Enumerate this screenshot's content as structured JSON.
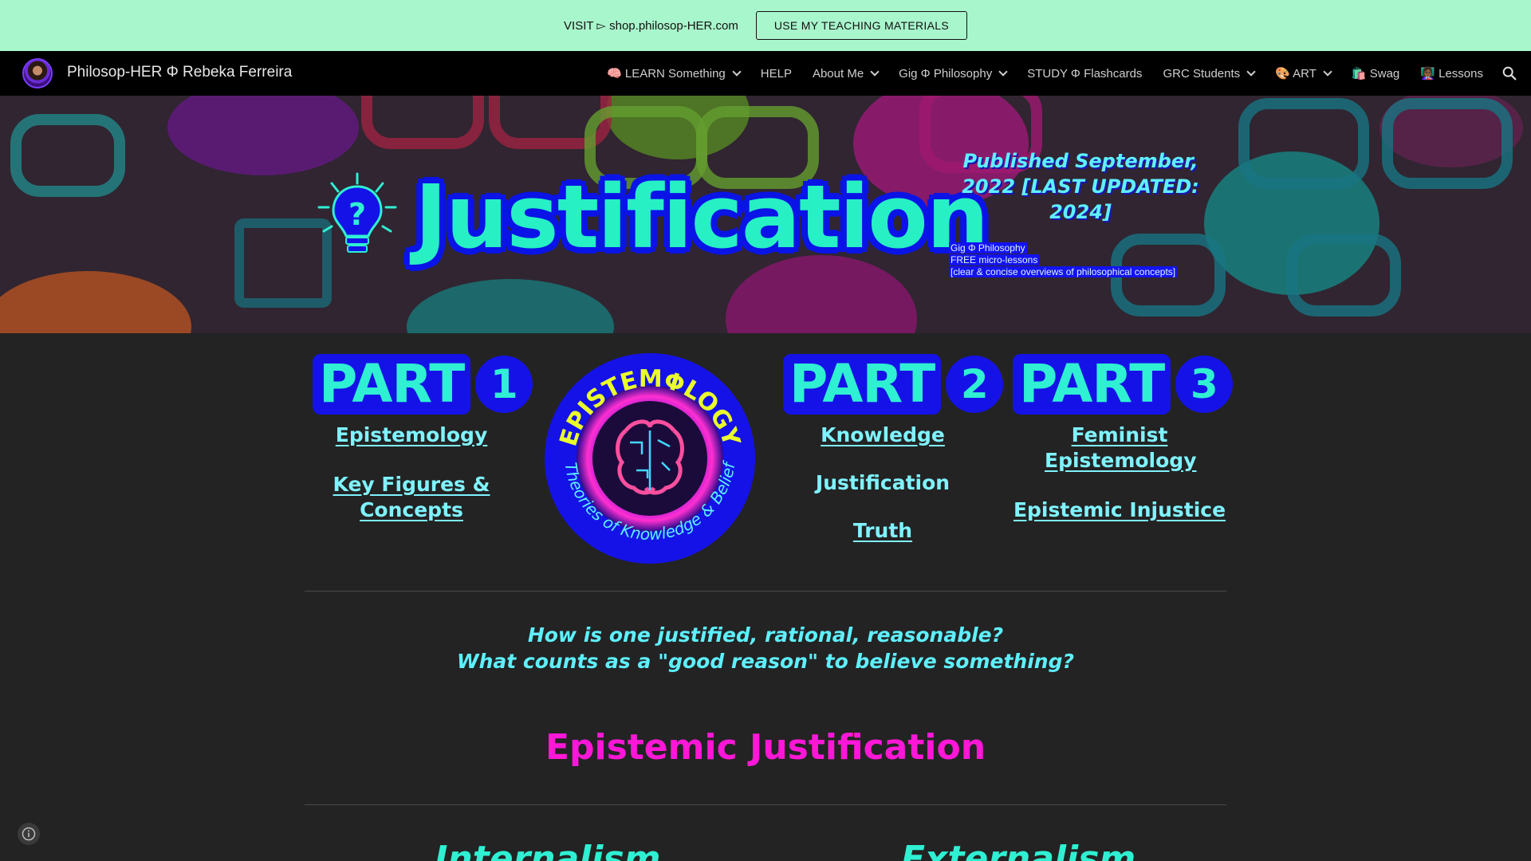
{
  "promo": {
    "text": "VISIT ▻ shop.philosop-HER.com",
    "button": "USE MY TEACHING MATERIALS"
  },
  "nav": {
    "site_title": "Philosop-HER Φ Rebeka Ferreira",
    "items": [
      {
        "label": "🧠 LEARN Something",
        "dropdown": true
      },
      {
        "label": "HELP",
        "dropdown": false
      },
      {
        "label": "About Me",
        "dropdown": true
      },
      {
        "label": "Gig Φ Philosophy",
        "dropdown": true
      },
      {
        "label": "STUDY Φ Flashcards",
        "dropdown": false
      },
      {
        "label": "GRC Students",
        "dropdown": true
      },
      {
        "label": "🎨 ART",
        "dropdown": true
      },
      {
        "label": "🛍️ Swag",
        "dropdown": false
      },
      {
        "label": "👩🏾‍🏫 Lessons",
        "dropdown": false
      }
    ]
  },
  "hero": {
    "title": "Justification",
    "published": "Published September, 2022 [LAST UPDATED: 2024]",
    "micro_lines": [
      "Gig Φ Philosophy",
      "FREE micro-lessons",
      "[clear & concise overviews of philosophical concepts]"
    ]
  },
  "parts": {
    "part_word": "PART",
    "p1": {
      "num": "1",
      "links": [
        "Epistemology",
        "Key Figures & Concepts"
      ]
    },
    "p2": {
      "num": "2",
      "link1": "Knowledge",
      "current": "Justification",
      "link2": "Truth"
    },
    "p3": {
      "num": "3",
      "links": [
        "Feminist Epistemology",
        "Epistemic Injustice"
      ]
    }
  },
  "logo": {
    "top_text": "EPISTEMΦLOGY",
    "bottom_text": "Theories of Knowledge & Belief"
  },
  "questions": {
    "line1": "How is one justified, rational, reasonable?",
    "line2": "What counts as a \"good reason\" to believe something?"
  },
  "section_title": "Epistemic Justification",
  "subheads": {
    "left": "Internalism",
    "right": "Externalism"
  },
  "colors": {
    "banner": "#a8f6cc",
    "cyan": "#2ff0d2",
    "blue": "#1512e8",
    "magenta": "#ff17d7"
  }
}
